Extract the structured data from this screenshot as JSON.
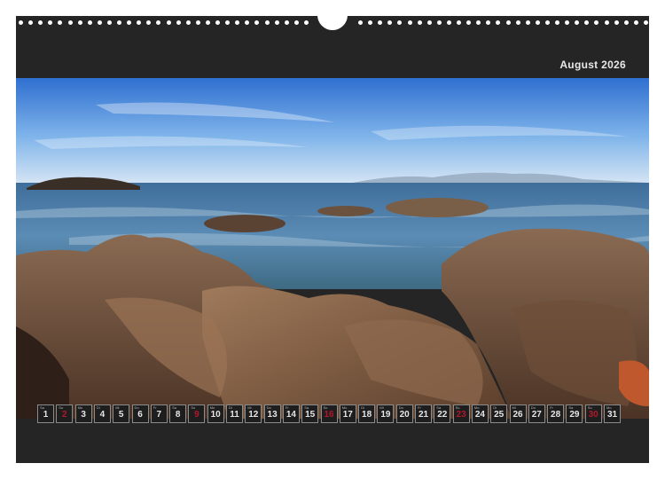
{
  "calendar": {
    "month_title": "August 2026",
    "days": [
      {
        "wd": "Sa",
        "num": "1",
        "holiday": false
      },
      {
        "wd": "So",
        "num": "2",
        "holiday": true
      },
      {
        "wd": "Mo",
        "num": "3",
        "holiday": false
      },
      {
        "wd": "Di",
        "num": "4",
        "holiday": false
      },
      {
        "wd": "Mi",
        "num": "5",
        "holiday": false
      },
      {
        "wd": "Do",
        "num": "6",
        "holiday": false
      },
      {
        "wd": "Fr",
        "num": "7",
        "holiday": false
      },
      {
        "wd": "Sa",
        "num": "8",
        "holiday": false
      },
      {
        "wd": "So",
        "num": "9",
        "holiday": true
      },
      {
        "wd": "Mo",
        "num": "10",
        "holiday": false
      },
      {
        "wd": "Di",
        "num": "11",
        "holiday": false
      },
      {
        "wd": "Mi",
        "num": "12",
        "holiday": false
      },
      {
        "wd": "Do",
        "num": "13",
        "holiday": false
      },
      {
        "wd": "Fr",
        "num": "14",
        "holiday": false
      },
      {
        "wd": "Sa",
        "num": "15",
        "holiday": false
      },
      {
        "wd": "So",
        "num": "16",
        "holiday": true
      },
      {
        "wd": "Mo",
        "num": "17",
        "holiday": false
      },
      {
        "wd": "Di",
        "num": "18",
        "holiday": false
      },
      {
        "wd": "Mi",
        "num": "19",
        "holiday": false
      },
      {
        "wd": "Do",
        "num": "20",
        "holiday": false
      },
      {
        "wd": "Fr",
        "num": "21",
        "holiday": false
      },
      {
        "wd": "Sa",
        "num": "22",
        "holiday": false
      },
      {
        "wd": "So",
        "num": "23",
        "holiday": true
      },
      {
        "wd": "Mo",
        "num": "24",
        "holiday": false
      },
      {
        "wd": "Di",
        "num": "25",
        "holiday": false
      },
      {
        "wd": "Mi",
        "num": "26",
        "holiday": false
      },
      {
        "wd": "Do",
        "num": "27",
        "holiday": false
      },
      {
        "wd": "Fr",
        "num": "28",
        "holiday": false
      },
      {
        "wd": "Sa",
        "num": "29",
        "holiday": false
      },
      {
        "wd": "So",
        "num": "30",
        "holiday": true
      },
      {
        "wd": "Mo",
        "num": "31",
        "holiday": false
      }
    ]
  },
  "colors": {
    "background": "#252525",
    "holiday": "#b2182b",
    "day_text": "#e6e6e6"
  },
  "icons": {
    "hanger": "hanger-hole-icon",
    "binding": "wire-binding-icon"
  }
}
